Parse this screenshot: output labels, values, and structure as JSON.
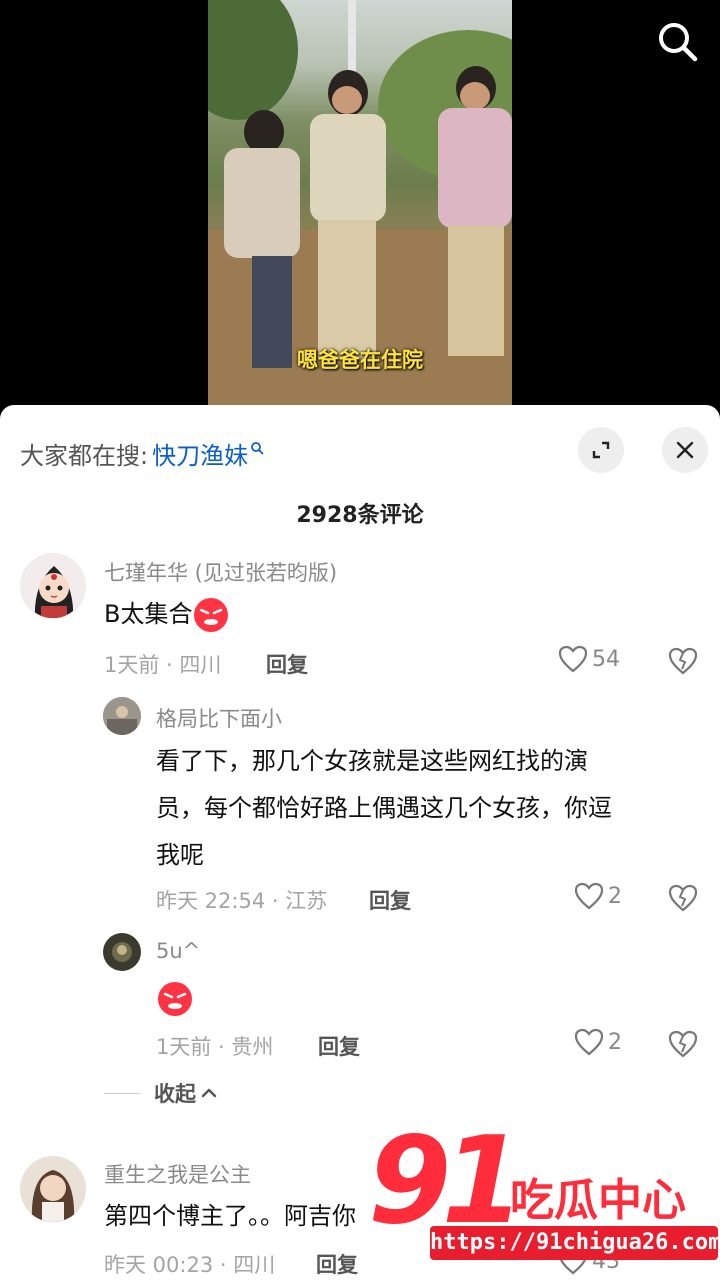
{
  "video": {
    "subtitle": "嗯爸爸在住院",
    "search_icon": "search-icon"
  },
  "panel": {
    "hot_search_prefix": "大家都在搜:",
    "hot_search_term": "快刀渔妹",
    "comment_count": "2928条评论",
    "expand_icon": "expand-icon",
    "close_icon": "close-icon"
  },
  "comments": [
    {
      "username": "七瑾年华 (见过张若昀版)",
      "text": "B太集合",
      "emoji": "angry-face-emoji",
      "time": "1天前 · 四川",
      "reply": "回复",
      "likes": "54",
      "replies": [
        {
          "username": "格局比下面小",
          "text_line1": "看了下，那几个女孩就是这些网红找的演",
          "text_line2": "员，每个都恰好路上偶遇这几个女孩，你逗",
          "text_line3": "我呢",
          "time": "昨天 22:54 · 江苏",
          "reply": "回复",
          "likes": "2"
        },
        {
          "username": "5u^",
          "emoji": "angry-face-emoji",
          "time": "1天前 · 贵州",
          "reply": "回复",
          "likes": "2"
        }
      ],
      "collapse_label": "收起"
    },
    {
      "username": "重生之我是公主",
      "text": "第四个博主了。。阿吉你",
      "time": "昨天 00:23 · 四川",
      "reply": "回复",
      "likes": "43"
    }
  ],
  "watermark": {
    "number": "91",
    "name": "吃瓜中心",
    "url": "https://91chigua26.com"
  },
  "colors": {
    "link_blue": "#0c5ec9",
    "watermark_red": "#ff2d3c",
    "subtitle_yellow": "#ffe23a"
  }
}
